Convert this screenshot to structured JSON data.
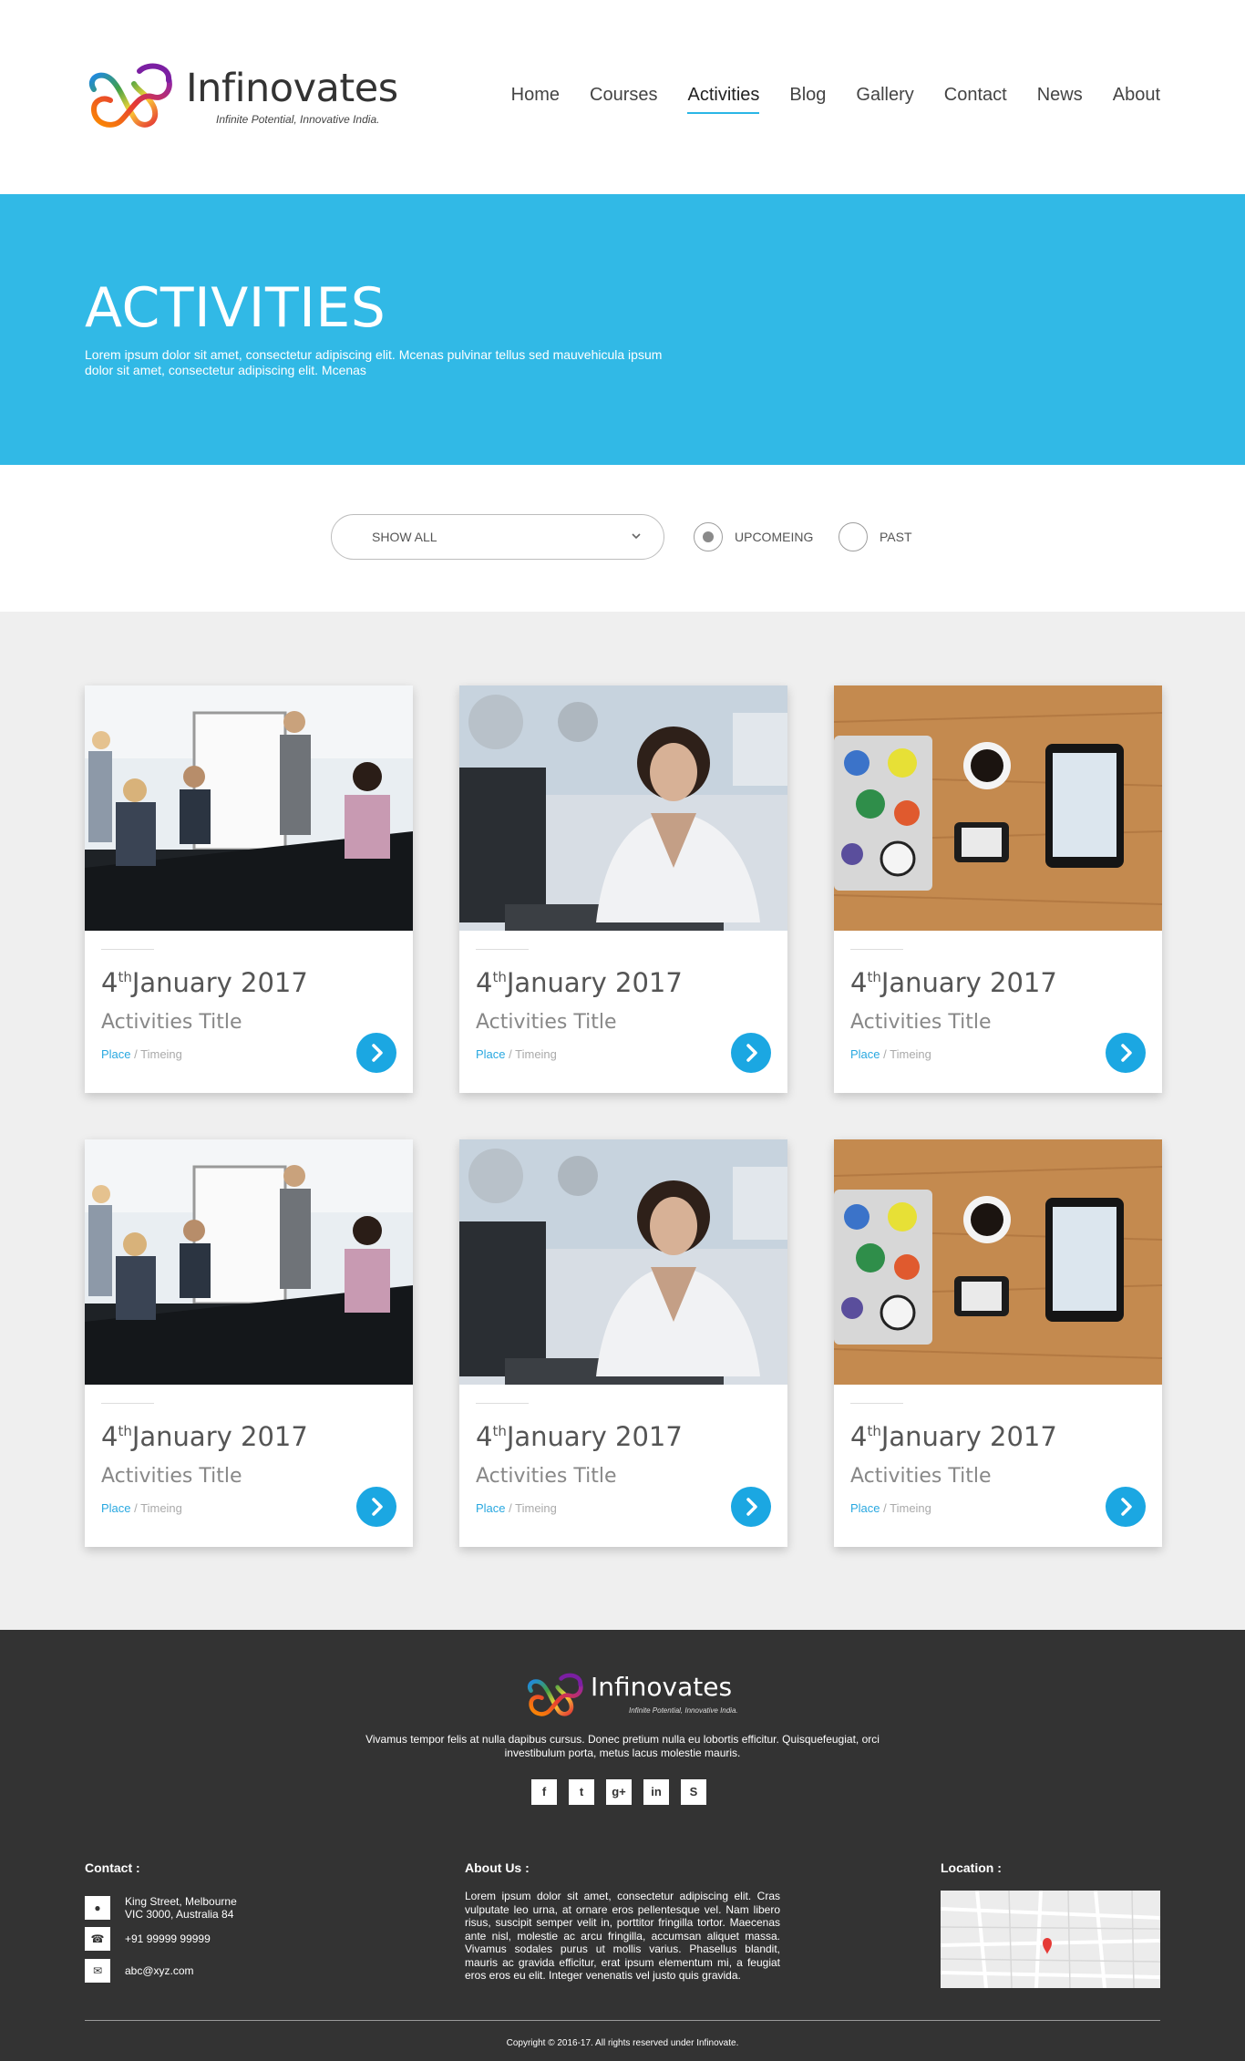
{
  "brand": {
    "name": "Infinovates",
    "tagline": "Infinite Potential, Innovative India."
  },
  "nav": {
    "items": [
      "Home",
      "Courses",
      "Activities",
      "Blog",
      "Gallery",
      "Contact",
      "News",
      "About"
    ],
    "active": "Activities"
  },
  "hero": {
    "title": "ACTIVITIES",
    "text": "Lorem ipsum dolor sit amet, consectetur adipiscing elit. Mcenas pulvinar tellus sed mauvehicula ipsum dolor sit amet, consectetur adipiscing elit. Mcenas"
  },
  "filter": {
    "select_value": "SHOW ALL",
    "radio_upcoming": "UPCOMEING",
    "radio_past": "PAST",
    "selected": "UPCOMEING"
  },
  "cards": [
    {
      "day": "4",
      "suffix": "th",
      "rest": "January 2017",
      "title": "Activities Title",
      "place": "Place",
      "sep": " / ",
      "timing": "Timeing",
      "image": "meeting-photo"
    },
    {
      "day": "4",
      "suffix": "th",
      "rest": "January 2017",
      "title": "Activities Title",
      "place": "Place",
      "sep": " / ",
      "timing": "Timeing",
      "image": "businesswoman-photo"
    },
    {
      "day": "4",
      "suffix": "th",
      "rest": "January 2017",
      "title": "Activities Title",
      "place": "Place",
      "sep": " / ",
      "timing": "Timeing",
      "image": "desk-devices-photo"
    },
    {
      "day": "4",
      "suffix": "th",
      "rest": "January 2017",
      "title": "Activities Title",
      "place": "Place",
      "sep": " / ",
      "timing": "Timeing",
      "image": "meeting-photo"
    },
    {
      "day": "4",
      "suffix": "th",
      "rest": "January 2017",
      "title": "Activities Title",
      "place": "Place",
      "sep": " / ",
      "timing": "Timeing",
      "image": "businesswoman-photo"
    },
    {
      "day": "4",
      "suffix": "th",
      "rest": "January 2017",
      "title": "Activities Title",
      "place": "Place",
      "sep": " / ",
      "timing": "Timeing",
      "image": "desk-devices-photo"
    }
  ],
  "footer": {
    "brand": "Infinovates",
    "tagline": "Infinite Potential, Innovative India.",
    "description": "Vivamus tempor felis at nulla dapibus cursus. Donec pretium nulla eu lobortis efficitur. Quisquefeugiat, orci investibulum porta, metus lacus molestie mauris.",
    "social": [
      "facebook-icon",
      "twitter-icon",
      "google-plus-icon",
      "linkedin-icon",
      "skype-icon"
    ],
    "contact_heading": "Contact :",
    "address_line1": "King Street, Melbourne",
    "address_line2": "VIC 3000, Australia 84",
    "phone": "+91 99999 99999",
    "email": "abc@xyz.com",
    "about_heading": "About Us :",
    "about_text": "Lorem ipsum dolor sit amet, consectetur adipiscing elit. Cras vulputate leo urna, at ornare eros pellentesque vel. Nam libero risus, suscipit semper velit in, porttitor fringilla tortor. Maecenas ante nisl, molestie ac arcu fringilla, accumsan aliquet massa. Vivamus sodales purus ut mollis varius. Phasellus blandit, mauris ac gravida efficitur, erat ipsum elementum mi, a feugiat eros eros eu elit. Integer venenatis vel justo quis gravida.",
    "location_heading": "Location :",
    "copyright": "Copyright © 2016-17. All rights reserved under Infinovate."
  },
  "colors": {
    "accent": "#31b9e6",
    "button": "#1ba7e2",
    "footer_bg": "#333333",
    "grid_bg": "#efefef"
  }
}
